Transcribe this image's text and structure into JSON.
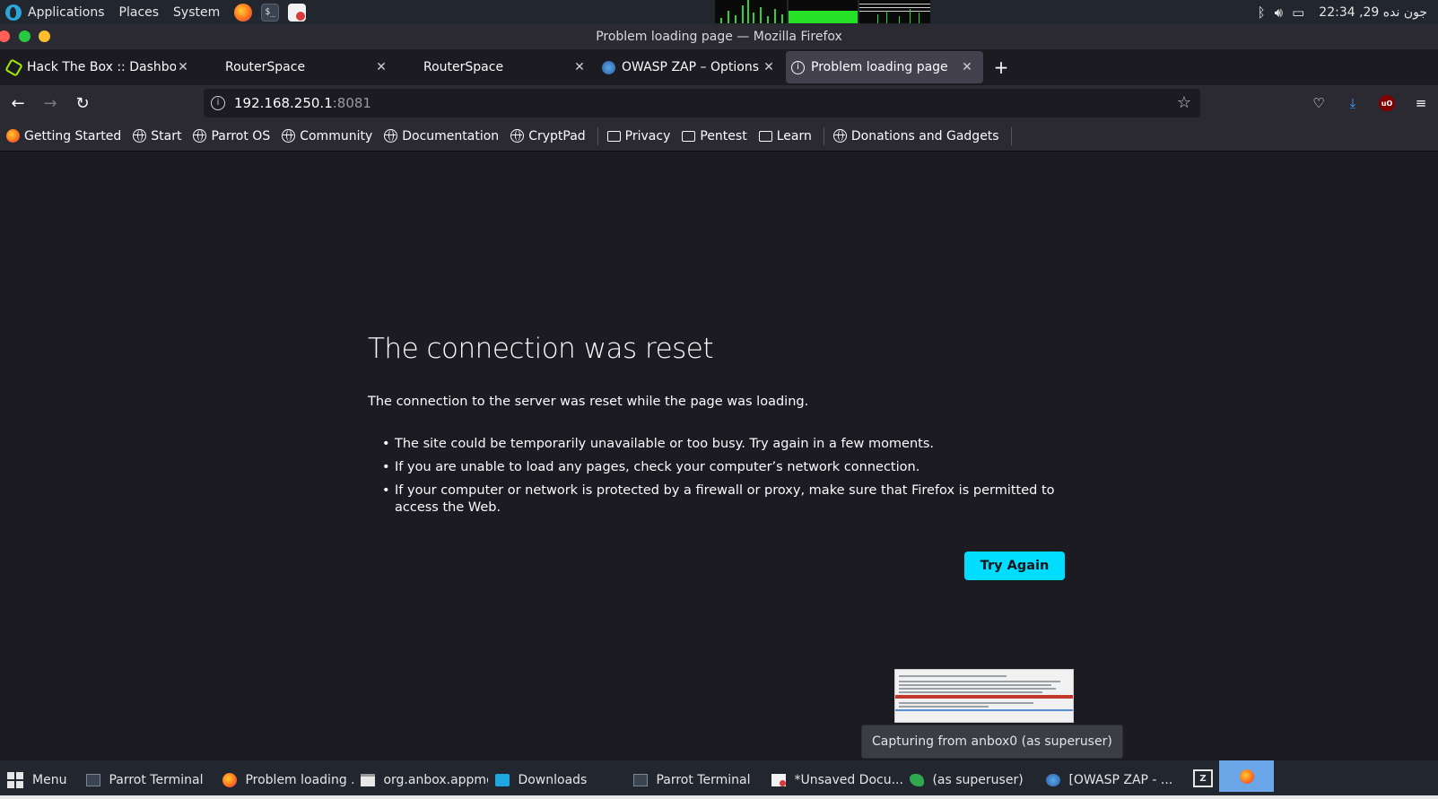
{
  "top_panel": {
    "menus": [
      "Applications",
      "Places",
      "System"
    ],
    "clock": "22:34 ,29 جون ندە"
  },
  "window": {
    "title": "Problem loading page — Mozilla Firefox"
  },
  "tabs": [
    {
      "title": "Hack The Box :: Dashboard",
      "favicon": "hackthebox-icon",
      "active": false
    },
    {
      "title": "RouterSpace",
      "favicon": "",
      "active": false
    },
    {
      "title": "RouterSpace",
      "favicon": "",
      "active": false
    },
    {
      "title": "OWASP ZAP – Options L",
      "favicon": "zap-icon",
      "active": false
    },
    {
      "title": "Problem loading page",
      "favicon": "info-icon",
      "active": true
    }
  ],
  "urlbar": {
    "host": "192.168.250.1",
    "port": ":8081"
  },
  "bookmarks": [
    {
      "label": "Getting Started",
      "icon": "firefox-icon"
    },
    {
      "label": "Start",
      "icon": "globe-icon"
    },
    {
      "label": "Parrot OS",
      "icon": "globe-icon"
    },
    {
      "label": "Community",
      "icon": "globe-icon"
    },
    {
      "label": "Documentation",
      "icon": "globe-icon"
    },
    {
      "label": "CryptPad",
      "icon": "globe-icon"
    },
    {
      "label": "Privacy",
      "icon": "folder-icon"
    },
    {
      "label": "Pentest",
      "icon": "folder-icon"
    },
    {
      "label": "Learn",
      "icon": "folder-icon"
    },
    {
      "label": "Donations and Gadgets",
      "icon": "globe-icon"
    }
  ],
  "error_page": {
    "title": "The connection was reset",
    "description": "The connection to the server was reset while the page was loading.",
    "bullets": [
      "The site could be temporarily unavailable or too busy. Try again in a few moments.",
      "If you are unable to load any pages, check your computer’s network connection.",
      "If your computer or network is protected by a firewall or proxy, make sure that Firefox is permitted to access the Web."
    ],
    "button": "Try Again"
  },
  "notification": {
    "label": "Capturing from anbox0 (as superuser)"
  },
  "taskbar": {
    "menu_label": "Menu",
    "items": [
      {
        "label": "Parrot Terminal",
        "icon": "terminal-icon",
        "active": false
      },
      {
        "label": "Problem loading ...",
        "icon": "firefox-icon",
        "active": true
      },
      {
        "label": "org.anbox.appmgr",
        "icon": "window-icon",
        "active": false
      },
      {
        "label": "Downloads",
        "icon": "folder-icon",
        "active": false
      },
      {
        "label": "Parrot Terminal",
        "icon": "terminal-icon",
        "active": false
      },
      {
        "label": "*Unsaved Docu...",
        "icon": "text-editor-icon",
        "active": false
      },
      {
        "label": "(as superuser)",
        "icon": "wireshark-icon",
        "active": false
      },
      {
        "label": "[OWASP ZAP - ...",
        "icon": "zap-icon",
        "active": false
      }
    ]
  },
  "colors": {
    "accent_button": "#00ddff",
    "content_bg": "#1c1b22",
    "toolbar_bg": "#2b2a33"
  }
}
